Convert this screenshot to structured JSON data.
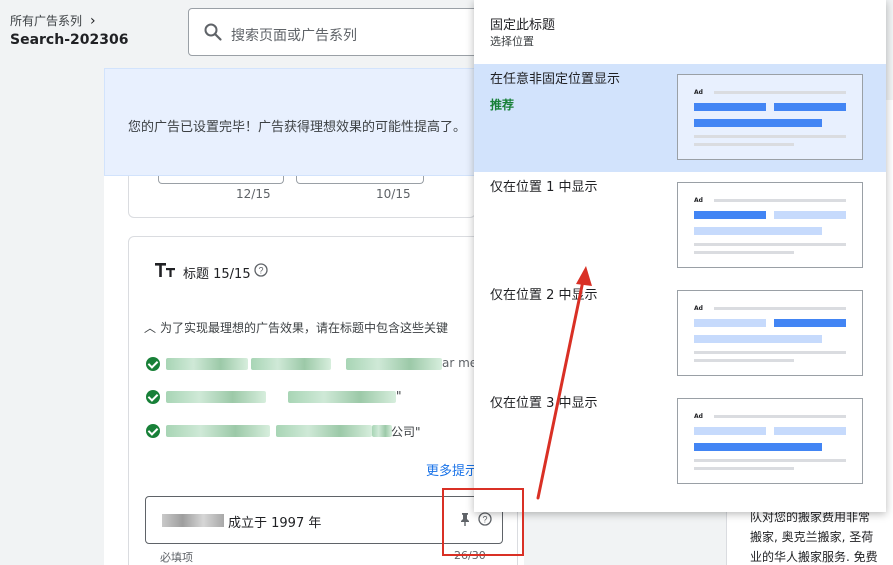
{
  "breadcrumb": {
    "parent": "所有广告系列",
    "current": "Search-202306"
  },
  "search": {
    "placeholder": "搜索页面或广告系列"
  },
  "banner": {
    "text": "您的广告已设置完毕！广告获得理想效果的可能性提高了。"
  },
  "description_counts": [
    "12/15",
    "10/15"
  ],
  "headlines": {
    "label": "标题 15/15",
    "tip": "为了实现最理想的广告效果，请在标题中包含这些关键",
    "keywords": [
      "ar me",
      "\"",
      "公司\""
    ],
    "more_tips": "更多提示",
    "input_value": "成立于 1997 年",
    "required": "必填项",
    "char_count": "26/30"
  },
  "pin_popup": {
    "title": "固定此标题",
    "subtitle": "选择位置",
    "options": [
      {
        "label": "在任意非固定位置显示",
        "recommended": "推荐",
        "selected": true
      },
      {
        "label": "仅在位置 1 中显示",
        "selected": false
      },
      {
        "label": "仅在位置 2 中显示",
        "selected": false
      },
      {
        "label": "仅在位置 3 中显示",
        "selected": false
      }
    ],
    "ad_tag": "Ad"
  },
  "preview": {
    "lines": [
      "队对您的搬家费用非常",
      "搬家, 奥克兰搬家, 圣荷",
      "业的华人搬家服务. 免费"
    ]
  },
  "colors": {
    "accent": "#1a73e8",
    "success": "#188038",
    "highlight": "#d93025",
    "selected_bg": "#d2e3fc"
  }
}
